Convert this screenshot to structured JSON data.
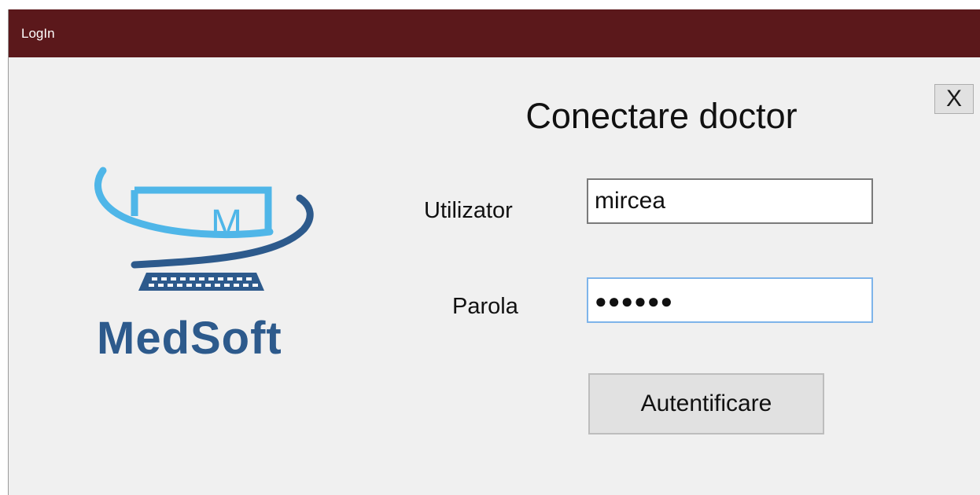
{
  "window": {
    "title": "LogIn",
    "close_label": "X"
  },
  "logo": {
    "letter": "M",
    "name": "MedSoft"
  },
  "form": {
    "heading": "Conectare doctor",
    "username_label": "Utilizator",
    "username_value": "mircea",
    "password_label": "Parola",
    "password_masked": "●●●●●●",
    "submit_label": "Autentificare"
  },
  "colors": {
    "titlebar": "#5b181b",
    "logo_light_blue": "#4fb6e8",
    "logo_dark_blue": "#2d5a8c",
    "focus_border": "#7eb4ea"
  }
}
